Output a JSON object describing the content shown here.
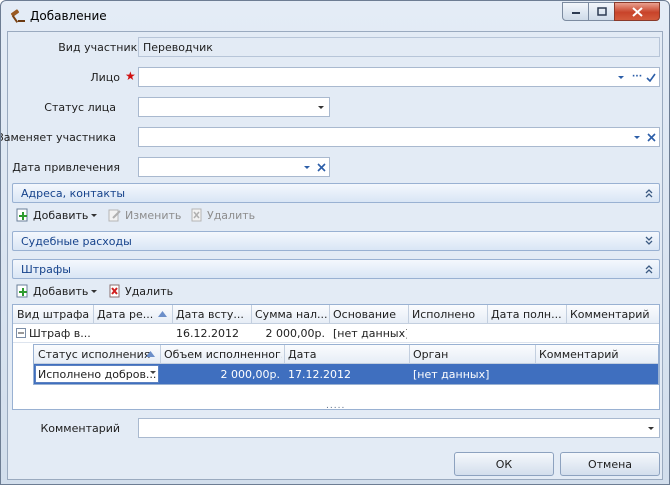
{
  "window": {
    "title": "Добавление"
  },
  "fields": [
    {
      "label": "Вид участника",
      "value": "Переводчик"
    },
    {
      "label": "Лицо",
      "required_mark": "★",
      "value": ""
    },
    {
      "label": "Статус лица",
      "value": ""
    },
    {
      "label": "Заменяет участника",
      "value": ""
    },
    {
      "label": "Дата привлечения",
      "value": ""
    }
  ],
  "sections": {
    "addresses": {
      "title": "Адреса, контакты",
      "add": "Добавить",
      "edit": "Изменить",
      "delete": "Удалить"
    },
    "court_costs": {
      "title": "Судебные расходы"
    },
    "fines": {
      "title": "Штрафы",
      "add": "Добавить",
      "delete": "Удалить"
    }
  },
  "fines_grid": {
    "columns": [
      "Вид штрафа",
      "Дата ре...",
      "Дата всту...",
      "Сумма нал...",
      "Основание",
      "Исполнено",
      "Дата полн...",
      "Комментарий"
    ],
    "rows": [
      {
        "type": "Штраф в...",
        "date_decision": "",
        "date_effective": "16.12.2012",
        "amount": "2 000,00р.",
        "basis": "[нет данных]",
        "executed": "",
        "date_full": "",
        "comment": ""
      }
    ],
    "detail": {
      "columns": [
        "Статус исполнения",
        "Объем исполненног...",
        "Дата",
        "Орган",
        "Комментарий"
      ],
      "row": {
        "status": "Исполнено добров...",
        "volume": "2 000,00р.",
        "date": "17.12.2012",
        "organ": "[нет данных]",
        "comment": ""
      }
    },
    "splitter": "....."
  },
  "comment": {
    "label": "Комментарий",
    "value": ""
  },
  "buttons": {
    "ok": "ОК",
    "cancel": "Отмена"
  }
}
